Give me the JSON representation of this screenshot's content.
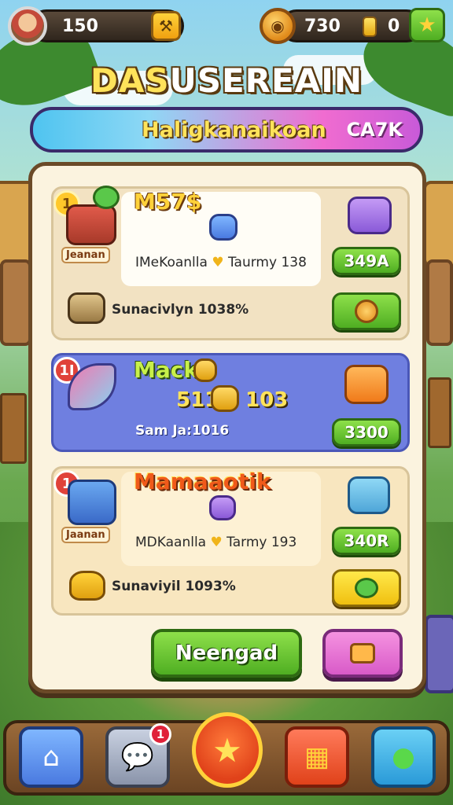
{
  "topbar": {
    "left_value": "150",
    "right_value_a": "730",
    "right_value_b": "0",
    "icons": [
      "player-avatar",
      "wrench-icon",
      "coin-icon",
      "gem-icon",
      "star-icon"
    ]
  },
  "title": {
    "part1": "DAS",
    "part2": "USEREAIN"
  },
  "banner": {
    "text": "Haligkanaikoan",
    "tag": "CA7K"
  },
  "cards": [
    {
      "badge": "1",
      "item_label": "Jeanan",
      "title": "M57$",
      "desc_a": "IMeKoanlla",
      "desc_b": "Taurmy 138",
      "price": "349A",
      "sub_text": "Sunacivlyn 1038%"
    },
    {
      "badge": "1I",
      "title": "Mack",
      "value_a": "511",
      "value_b": "103",
      "desc": "Sam Ja:1016",
      "price": "3300"
    },
    {
      "badge": "1",
      "item_label": "Jaanan",
      "title": "Mamaaotik",
      "desc_a": "MDKaanlla",
      "desc_b": "Tarmy 193",
      "price": "340R",
      "sub_text": "Sunaviyil 1093%"
    }
  ],
  "actions": {
    "primary": "Neengad"
  },
  "bottom_nav": {
    "notification_count": "1",
    "items": [
      "home-icon",
      "chat-icon",
      "star-icon",
      "shop-icon",
      "message-icon"
    ]
  },
  "colors": {
    "accent_yellow": "#ffd23a",
    "button_green": "#4fae22",
    "panel_bg": "#fbf3df",
    "card2_bg": "#6f7fe0"
  }
}
